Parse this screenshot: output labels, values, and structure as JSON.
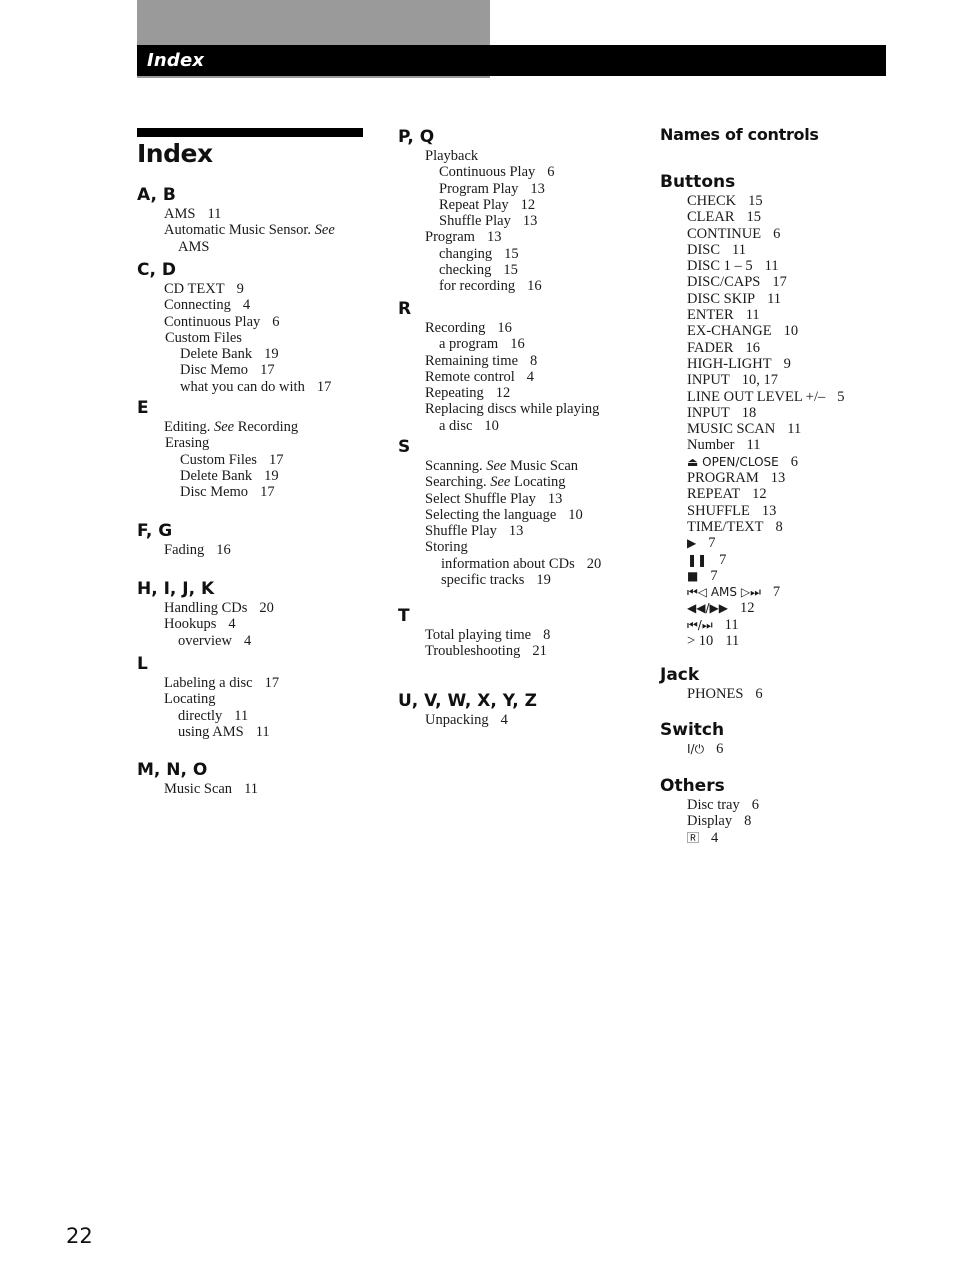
{
  "header": {
    "section_title": "Index"
  },
  "page_title": "Index",
  "page_number": "22",
  "column1": [
    {
      "heading": "A, B",
      "entries": [
        {
          "text": "AMS",
          "page": "11",
          "level": 1
        },
        {
          "text": "Automatic Music Sensor.",
          "see": "See",
          "level": 1
        },
        {
          "text": "AMS",
          "level": "cont"
        }
      ]
    },
    {
      "heading": "C, D",
      "entries": [
        {
          "text": "CD TEXT",
          "page": "9",
          "level": 1
        },
        {
          "text": "Connecting",
          "page": "4",
          "level": 1
        },
        {
          "text": "Continuous Play",
          "page": "6",
          "level": 1
        },
        {
          "text": "Custom Files",
          "level": "1b"
        },
        {
          "text": "Delete Bank",
          "page": "19",
          "level": 2
        },
        {
          "text": "Disc Memo",
          "page": "17",
          "level": 2
        },
        {
          "text": "what you can do with",
          "page": "17",
          "level": 2
        }
      ]
    },
    {
      "heading": "E",
      "entries": [
        {
          "text": "Editing.",
          "see": "See",
          "see_target": "Recording",
          "level": 1
        },
        {
          "text": "Erasing",
          "level": "1b"
        },
        {
          "text": "Custom Files",
          "page": "17",
          "level": 2
        },
        {
          "text": "Delete Bank",
          "page": "19",
          "level": 2
        },
        {
          "text": "Disc Memo",
          "page": "17",
          "level": 2
        }
      ]
    },
    {
      "heading": "F, G",
      "entries": [
        {
          "text": "Fading",
          "page": "16",
          "level": 1
        }
      ]
    },
    {
      "heading": "H, I, J, K",
      "entries": [
        {
          "text": "Handling CDs",
          "page": "20",
          "level": 1
        },
        {
          "text": "Hookups",
          "page": "4",
          "level": 1
        },
        {
          "text": "overview",
          "page": "4",
          "level": "cont"
        }
      ]
    },
    {
      "heading": "L",
      "entries": [
        {
          "text": "Labeling a disc",
          "page": "17",
          "level": 1
        },
        {
          "text": "Locating",
          "level": 1
        },
        {
          "text": "directly",
          "page": "11",
          "level": "cont"
        },
        {
          "text": "using AMS",
          "page": "11",
          "level": "cont"
        }
      ]
    },
    {
      "heading": "M, N, O",
      "entries": [
        {
          "text": "Music Scan",
          "page": "11",
          "level": 1
        }
      ]
    }
  ],
  "column2": [
    {
      "heading": "P, Q",
      "entries": [
        {
          "text": "Playback",
          "level": 1
        },
        {
          "text": "Continuous Play",
          "page": "6",
          "level": "cont"
        },
        {
          "text": "Program Play",
          "page": "13",
          "level": "cont"
        },
        {
          "text": "Repeat Play",
          "page": "12",
          "level": "cont"
        },
        {
          "text": "Shuffle Play",
          "page": "13",
          "level": "cont"
        },
        {
          "text": "Program",
          "page": "13",
          "level": 1
        },
        {
          "text": "changing",
          "page": "15",
          "level": "cont"
        },
        {
          "text": "checking",
          "page": "15",
          "level": "cont"
        },
        {
          "text": "for recording",
          "page": "16",
          "level": "cont"
        }
      ]
    },
    {
      "heading": "R",
      "entries": [
        {
          "text": "Recording",
          "page": "16",
          "level": 1
        },
        {
          "text": "a program",
          "page": "16",
          "level": "cont"
        },
        {
          "text": "Remaining time",
          "page": "8",
          "level": 1
        },
        {
          "text": "Remote control",
          "page": "4",
          "level": 1
        },
        {
          "text": "Repeating",
          "page": "12",
          "level": 1
        },
        {
          "text": "Replacing discs while playing",
          "level": 1
        },
        {
          "text": "a disc",
          "page": "10",
          "level": "cont"
        }
      ]
    },
    {
      "heading": "S",
      "entries": [
        {
          "text": "Scanning.",
          "see": "See",
          "see_target": "Music Scan",
          "level": 1
        },
        {
          "text": "Searching.",
          "see": "See",
          "see_target": "Locating",
          "level": 1
        },
        {
          "text": "Select Shuffle Play",
          "page": "13",
          "level": 1
        },
        {
          "text": "Selecting the language",
          "page": "10",
          "level": 1
        },
        {
          "text": "Shuffle Play",
          "page": "13",
          "level": 1
        },
        {
          "text": "Storing",
          "level": 1
        },
        {
          "text": "information about CDs",
          "page": "20",
          "level": 2
        },
        {
          "text": "specific tracks",
          "page": "19",
          "level": 2
        }
      ]
    },
    {
      "heading": "T",
      "entries": [
        {
          "text": "Total playing time",
          "page": "8",
          "level": 1
        },
        {
          "text": "Troubleshooting",
          "page": "21",
          "level": 1
        }
      ]
    },
    {
      "heading": "U, V, W, X, Y, Z",
      "entries": [
        {
          "text": "Unpacking",
          "page": "4",
          "level": 1
        }
      ]
    }
  ],
  "column3": {
    "title": "Names of controls",
    "groups": [
      {
        "heading": "Buttons",
        "entries": [
          {
            "text": "CHECK",
            "page": "15"
          },
          {
            "text": "CLEAR",
            "page": "15"
          },
          {
            "text": "CONTINUE",
            "page": "6"
          },
          {
            "text": "DISC",
            "page": "11"
          },
          {
            "text": "DISC 1 – 5",
            "page": "11"
          },
          {
            "text": "DISC/CAPS",
            "page": "17"
          },
          {
            "text": "DISC SKIP",
            "page": "11"
          },
          {
            "text": "ENTER",
            "page": "11"
          },
          {
            "text": "EX-CHANGE",
            "page": "10"
          },
          {
            "text": "FADER",
            "page": "16"
          },
          {
            "text": "HIGH-LIGHT",
            "page": "9"
          },
          {
            "text": "INPUT",
            "page": "10, 17"
          },
          {
            "text": "LINE OUT LEVEL +/–",
            "page": "5"
          },
          {
            "text": "INPUT",
            "page": "18"
          },
          {
            "text": "MUSIC SCAN",
            "page": "11"
          },
          {
            "text": "Number",
            "page": "11"
          },
          {
            "text": "⏏ OPEN/CLOSE",
            "page": "6",
            "icon": "eject-icon"
          },
          {
            "text": "PROGRAM",
            "page": "13"
          },
          {
            "text": "REPEAT",
            "page": "12"
          },
          {
            "text": "SHUFFLE",
            "page": "13"
          },
          {
            "text": "TIME/TEXT",
            "page": "8"
          },
          {
            "text": "▶",
            "page": "7",
            "icon": "play-icon"
          },
          {
            "text": "❚❚",
            "page": "7",
            "icon": "pause-icon"
          },
          {
            "text": "■",
            "page": "7",
            "icon": "stop-icon"
          },
          {
            "text": "⏮◁ AMS ▷⏭",
            "page": "7",
            "icon": "ams-skip-icon"
          },
          {
            "text": "◀◀/▶▶",
            "page": "12",
            "icon": "search-rewind-forward-icon"
          },
          {
            "text": "⏮/⏭",
            "page": "11",
            "icon": "skip-previous-next-icon"
          },
          {
            "text": "> 10",
            "page": "11"
          }
        ]
      },
      {
        "heading": "Jack",
        "entries": [
          {
            "text": "PHONES",
            "page": "6"
          }
        ]
      },
      {
        "heading": "Switch",
        "entries": [
          {
            "text": "I/⏻",
            "page": "6",
            "icon": "power-icon"
          }
        ]
      },
      {
        "heading": "Others",
        "entries": [
          {
            "text": "Disc tray",
            "page": "6"
          },
          {
            "text": "Display",
            "page": "8"
          },
          {
            "text": "🅁",
            "page": "4",
            "icon": "remote-sensor-icon"
          }
        ]
      }
    ]
  }
}
